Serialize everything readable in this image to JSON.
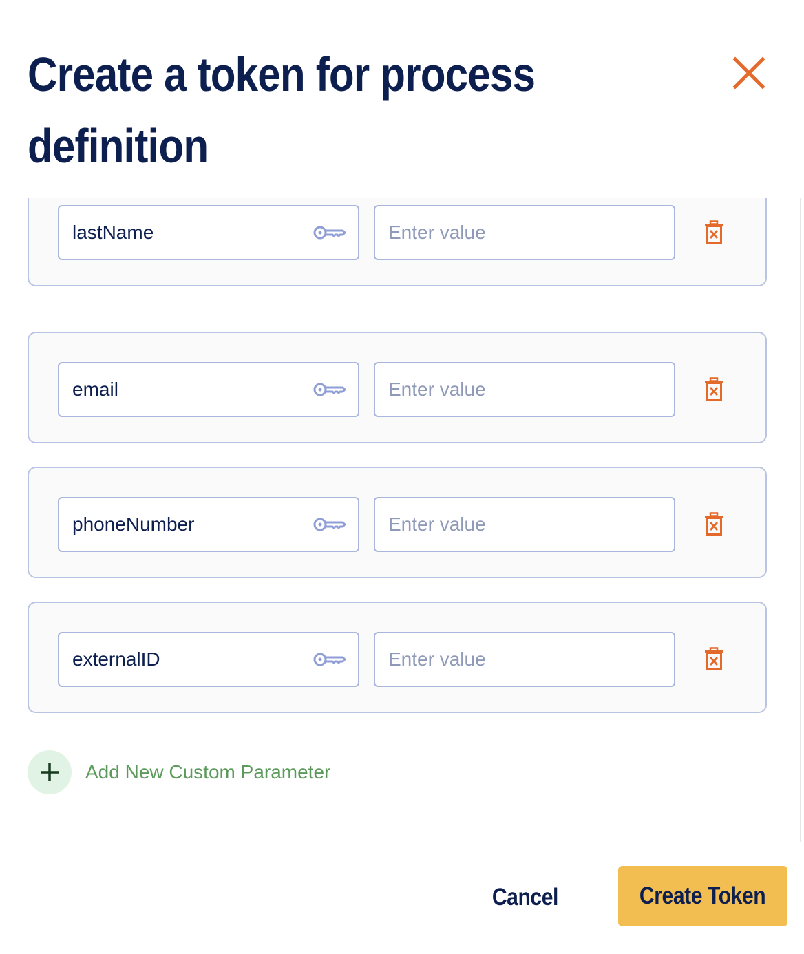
{
  "modal": {
    "title": "Create a token for process definition",
    "close_icon": "close-icon"
  },
  "params": [
    {
      "key": "lastName",
      "value": "",
      "value_placeholder": "Enter value"
    },
    {
      "key": "email",
      "value": "",
      "value_placeholder": "Enter value"
    },
    {
      "key": "phoneNumber",
      "value": "",
      "value_placeholder": "Enter value"
    },
    {
      "key": "externalID",
      "value": "",
      "value_placeholder": "Enter value"
    }
  ],
  "icons": {
    "key": "key-icon",
    "delete": "trash-icon",
    "add": "plus-icon"
  },
  "add_param_label": "Add New Custom Parameter",
  "footer": {
    "cancel_label": "Cancel",
    "create_label": "Create Token"
  },
  "colors": {
    "title": "#0c1f4f",
    "accent_orange": "#e46a2c",
    "primary_button": "#f2bd51",
    "field_border": "#aab6de",
    "add_green": "#5c9a5c"
  }
}
